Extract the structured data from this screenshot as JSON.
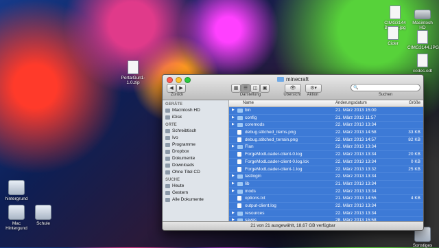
{
  "desktop": {
    "icons": [
      {
        "label": "PortalGun1-1.0.zip"
      },
      {
        "label": "hintergrund"
      },
      {
        "label": "Mac Hintergund"
      },
      {
        "label": "Schule"
      },
      {
        "label": "CIMG3144 Bear...t.jpg"
      },
      {
        "label": "Macintosh HD"
      },
      {
        "label": "Cider"
      },
      {
        "label": "CIMG3144.JPG"
      },
      {
        "label": "codes.odt"
      },
      {
        "label": "Sonstiges"
      }
    ]
  },
  "window": {
    "title": "minecraft",
    "toolbar": {
      "back_label": "Zurück",
      "view_label": "Darstellung",
      "quicklook_label": "Übersicht",
      "action_label": "Aktion",
      "search_label": "Suchen",
      "search_placeholder": ""
    },
    "sidebar": {
      "devices_header": "GERÄTE",
      "devices": [
        "Macintosh HD",
        "iDisk"
      ],
      "places_header": "ORTE",
      "places": [
        "Schreibtisch",
        "Ivo",
        "Programme",
        "Dropbox",
        "Dokumente",
        "Downloads",
        "Ohne Titel CD"
      ],
      "search_header": "SUCHE",
      "search_items": [
        "Heute",
        "Gestern",
        "Alle Dokumente"
      ]
    },
    "columns": {
      "name": "Name",
      "date": "Änderungsdatum",
      "size": "Größe"
    },
    "files": [
      {
        "name": "bin",
        "date": "21. März 2013 15:00",
        "size": "",
        "folder": true
      },
      {
        "name": "config",
        "date": "21. März 2013 11:57",
        "size": "",
        "folder": true
      },
      {
        "name": "coremods",
        "date": "22. März 2013 13:34",
        "size": "",
        "folder": true
      },
      {
        "name": "debug.stitched_items.png",
        "date": "22. März 2013 14:58",
        "size": "33 KB",
        "folder": false
      },
      {
        "name": "debug.stitched_terrain.png",
        "date": "22. März 2013 14:57",
        "size": "82 KB",
        "folder": false
      },
      {
        "name": "Flan",
        "date": "22. März 2013 13:34",
        "size": "",
        "folder": true
      },
      {
        "name": "ForgeModLoader-client-0.log",
        "date": "22. März 2013 13:34",
        "size": "20 KB",
        "folder": false
      },
      {
        "name": "ForgeModLoader-client-0.log.lck",
        "date": "22. März 2013 13:34",
        "size": "0 KB",
        "folder": false
      },
      {
        "name": "ForgeModLoader-client-1.log",
        "date": "22. März 2013 13:32",
        "size": "25 KB",
        "folder": false
      },
      {
        "name": "lastlogin",
        "date": "22. März 2013 13:34",
        "size": "",
        "folder": true
      },
      {
        "name": "lib",
        "date": "21. März 2013 13:34",
        "size": "",
        "folder": true
      },
      {
        "name": "mods",
        "date": "22. März 2013 13:34",
        "size": "",
        "folder": true
      },
      {
        "name": "options.txt",
        "date": "21. März 2013 14:55",
        "size": "4 KB",
        "folder": false
      },
      {
        "name": "output-client.log",
        "date": "22. März 2013 13:34",
        "size": "",
        "folder": false
      },
      {
        "name": "resources",
        "date": "22. März 2013 13:34",
        "size": "",
        "folder": true
      },
      {
        "name": "saves",
        "date": "28. März 2013 15:58",
        "size": "",
        "folder": true
      },
      {
        "name": "screenshots",
        "date": "28. Februar 2013 16:24",
        "size": "",
        "folder": true
      }
    ],
    "status": "21 von 21 ausgewählt, 18,67 GB verfügbar"
  }
}
